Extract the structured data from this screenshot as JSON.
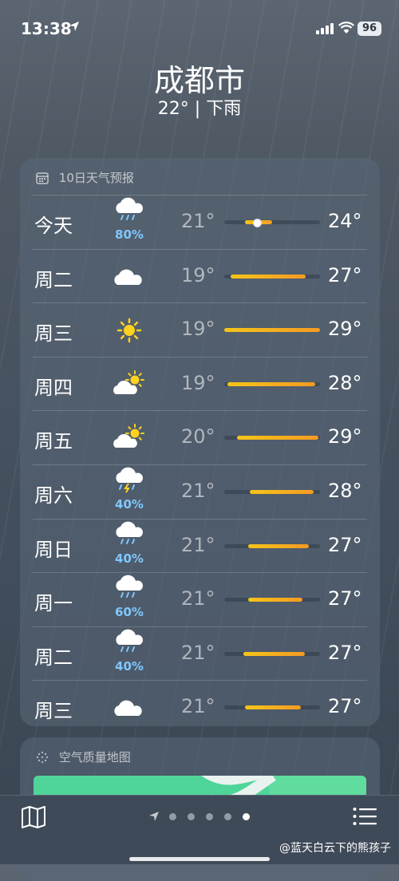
{
  "status": {
    "time": "13:38",
    "battery": "96"
  },
  "header": {
    "city": "成都市",
    "current": "22° | 下雨"
  },
  "forecast": {
    "title": "10日天气预报",
    "days": [
      {
        "day": "今天",
        "icon": "rain-cloud-icon",
        "pct": "80%",
        "low": "21°",
        "high": "24°",
        "range": [
          0.22,
          0.5
        ],
        "current": 0.33
      },
      {
        "day": "周二",
        "icon": "cloud-icon",
        "pct": "",
        "low": "19°",
        "high": "27°",
        "range": [
          0.07,
          0.85
        ]
      },
      {
        "day": "周三",
        "icon": "sun-icon",
        "pct": "",
        "low": "19°",
        "high": "29°",
        "range": [
          0.0,
          1.0
        ]
      },
      {
        "day": "周四",
        "icon": "partly-cloudy-icon",
        "pct": "",
        "low": "19°",
        "high": "28°",
        "range": [
          0.03,
          0.95
        ]
      },
      {
        "day": "周五",
        "icon": "partly-cloudy-icon",
        "pct": "",
        "low": "20°",
        "high": "29°",
        "range": [
          0.13,
          0.98
        ]
      },
      {
        "day": "周六",
        "icon": "thunder-rain-icon",
        "pct": "40%",
        "low": "21°",
        "high": "28°",
        "range": [
          0.27,
          0.93
        ]
      },
      {
        "day": "周日",
        "icon": "rain-cloud-icon",
        "pct": "40%",
        "low": "21°",
        "high": "27°",
        "range": [
          0.25,
          0.88
        ]
      },
      {
        "day": "周一",
        "icon": "rain-cloud-icon",
        "pct": "60%",
        "low": "21°",
        "high": "27°",
        "range": [
          0.25,
          0.82
        ]
      },
      {
        "day": "周二",
        "icon": "rain-cloud-icon",
        "pct": "40%",
        "low": "21°",
        "high": "27°",
        "range": [
          0.2,
          0.84
        ]
      },
      {
        "day": "周三",
        "icon": "cloud-icon",
        "pct": "",
        "low": "21°",
        "high": "27°",
        "range": [
          0.22,
          0.8
        ]
      }
    ]
  },
  "air_quality": {
    "title": "空气质量地图"
  },
  "pager": {
    "pages": 5,
    "active": 4
  },
  "watermark": "@蓝天白云下的熊孩子",
  "colors": {
    "precip": "#7fc7ff",
    "bar_start": "#f5c518",
    "bar_end": "#f59a23"
  }
}
